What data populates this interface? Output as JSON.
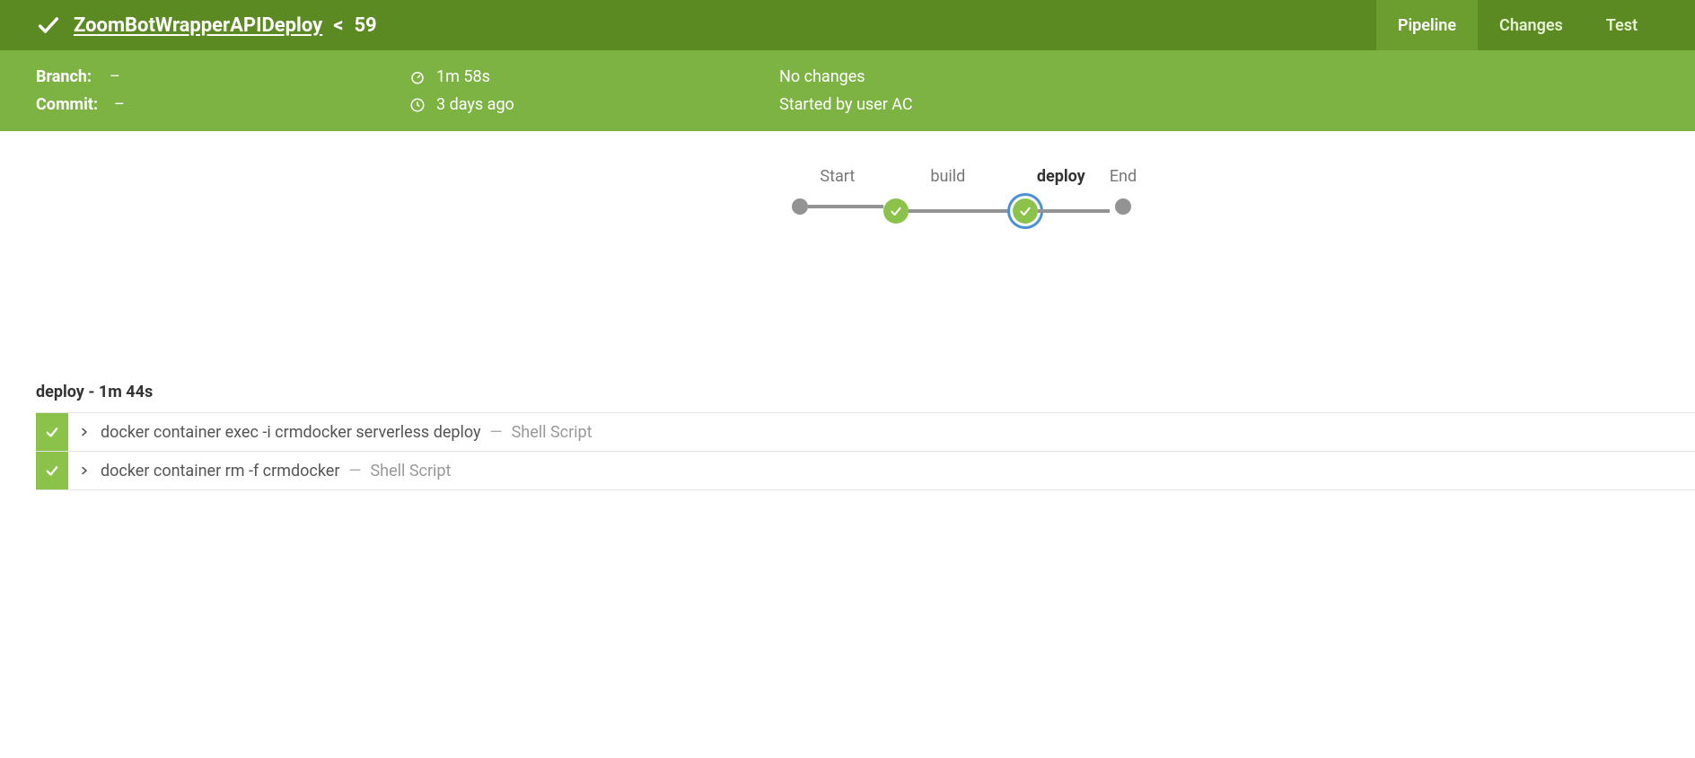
{
  "header": {
    "pipeline_name": "ZoomBotWrapperAPIDeploy",
    "build_number": "59",
    "tabs": [
      {
        "label": "Pipeline",
        "active": true
      },
      {
        "label": "Changes",
        "active": false
      },
      {
        "label": "Test",
        "active": false
      }
    ]
  },
  "info": {
    "branch_label": "Branch:",
    "branch_value": "–",
    "commit_label": "Commit:",
    "commit_value": "–",
    "duration": "1m 58s",
    "time_ago": "3 days ago",
    "changes": "No changes",
    "started_by": "Started by user AC"
  },
  "stages": [
    {
      "label": "Start",
      "type": "dot"
    },
    {
      "label": "build",
      "type": "success",
      "selected": false
    },
    {
      "label": "deploy",
      "type": "success",
      "selected": true
    },
    {
      "label": "End",
      "type": "dot"
    }
  ],
  "current_stage": {
    "name": "deploy",
    "duration": "1m 44s"
  },
  "steps": [
    {
      "command": "docker container exec -i crmdocker serverless deploy",
      "type": "Shell Script",
      "status": "success"
    },
    {
      "command": "docker container rm -f crmdocker",
      "type": "Shell Script",
      "status": "success"
    }
  ]
}
